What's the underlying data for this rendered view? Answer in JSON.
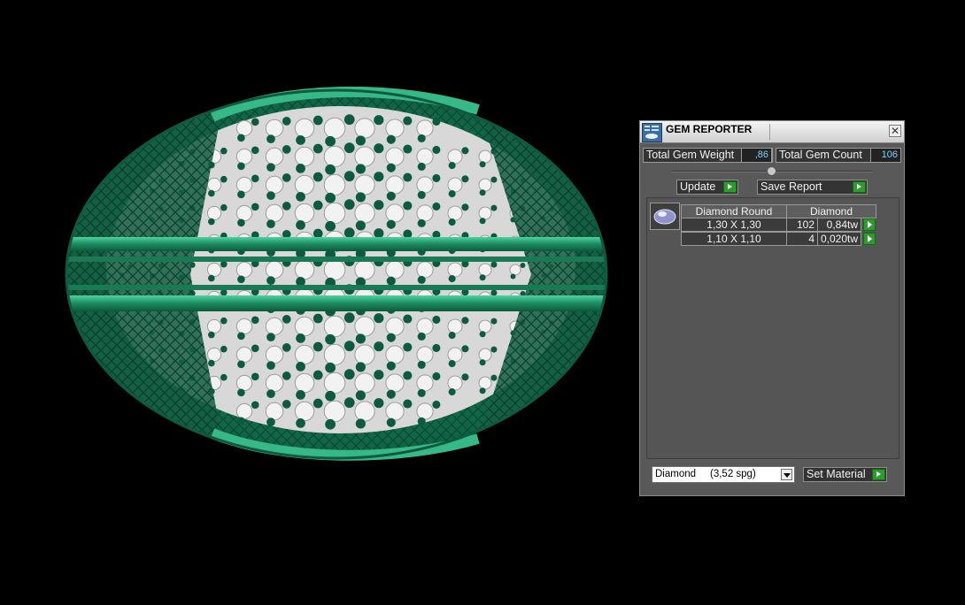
{
  "panel": {
    "title": "GEM REPORTER",
    "close_icon": "close-icon",
    "total_weight_label": "Total Gem Weight",
    "total_weight_value": ",86",
    "total_count_label": "Total Gem Count",
    "total_count_value": "106",
    "update_label": "Update",
    "save_report_label": "Save Report",
    "table": {
      "headers": [
        "Diamond Round",
        "Diamond"
      ],
      "rows": [
        {
          "size": "1,30 X 1,30",
          "count": "102",
          "weight": "0,84tw"
        },
        {
          "size": "1,10 X 1,10",
          "count": "4",
          "weight": "0,020tw"
        }
      ]
    },
    "material_select": "Diamond     (3,52 spg)",
    "set_material_label": "Set Material"
  },
  "colors": {
    "ring_green": "#1f8a64",
    "ring_dark": "#0e5a3e",
    "panel_bg": "#595959",
    "play_green": "#2f9a2f"
  }
}
